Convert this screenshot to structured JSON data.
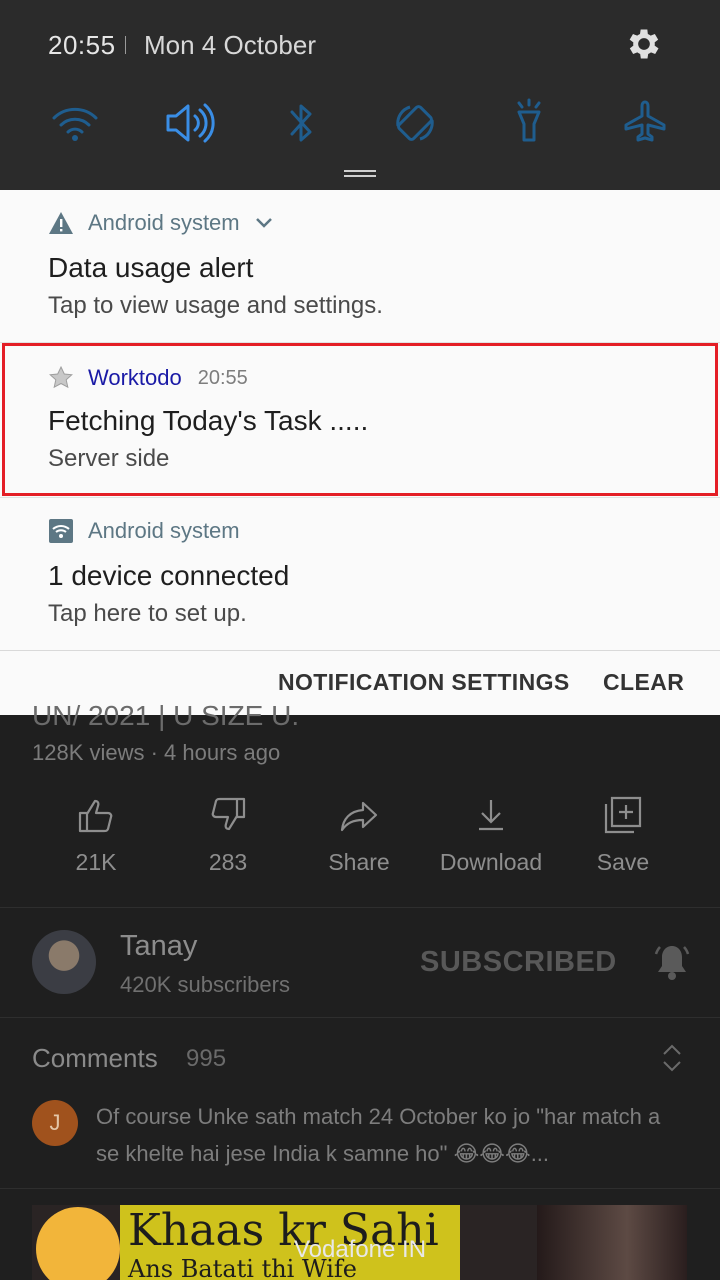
{
  "status": {
    "time": "20:55",
    "date": "Mon 4 October",
    "quick_tiles": [
      "wifi-icon",
      "sound-icon",
      "bluetooth-icon",
      "auto-rotate-icon",
      "flashlight-icon",
      "airplane-mode-icon"
    ],
    "active_tile_color": "#3a8ee6",
    "inactive_tile_color": "#1f5d8e"
  },
  "notifications": [
    {
      "app": "Android system",
      "title": "Data usage alert",
      "text": "Tap to view usage and settings.",
      "icon": "warning-icon"
    },
    {
      "app": "Worktodo",
      "time": "20:55",
      "title": "Fetching Today's Task  .....",
      "text": "Server side",
      "icon": "star-icon"
    },
    {
      "app": "Android system",
      "title": "1 device connected",
      "text": "Tap here to set up.",
      "icon": "wifi-share-icon"
    }
  ],
  "actions": {
    "settings": "NOTIFICATION SETTINGS",
    "clear": "CLEAR"
  },
  "video": {
    "title_fragment": "UN/ 2021 | U SIZE U.",
    "meta": "128K views · 4 hours ago",
    "likes": "21K",
    "dislikes": "283",
    "share": "Share",
    "download": "Download",
    "save": "Save"
  },
  "channel": {
    "name": "Tanay",
    "subscribers": "420K subscribers",
    "subscribed_label": "SUBSCRIBED"
  },
  "comments": {
    "label": "Comments",
    "count": "995",
    "first_author_initial": "J",
    "first_text": "Of course Unke sath match 24 October ko  jo \"har match a se khelte hai jese India k samne ho\" 😂😂😂..."
  },
  "thumbnail": {
    "line1": "Khaas kr Sahi",
    "line2": "Ans Batati thi Wife"
  },
  "carrier": "Vodafone IN"
}
